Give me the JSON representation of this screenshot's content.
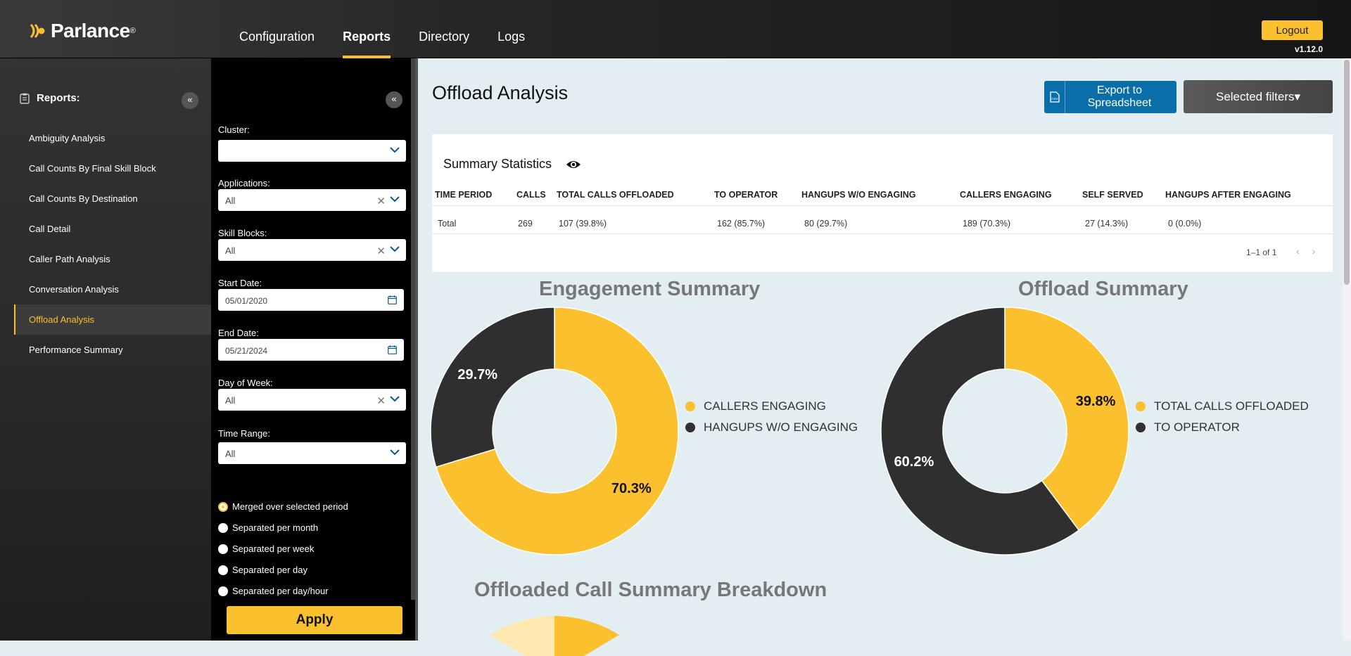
{
  "app": {
    "logo_text": "Parlance",
    "version": "v1.12.0",
    "logout": "Logout"
  },
  "nav": [
    "Configuration",
    "Reports",
    "Directory",
    "Logs"
  ],
  "sidebar": {
    "heading": "Reports:",
    "collapse_icon": "chevrons-left-icon",
    "items": [
      "Ambiguity Analysis",
      "Call Counts By Final Skill Block",
      "Call Counts By Destination",
      "Call Detail",
      "Caller Path Analysis",
      "Conversation Analysis",
      "Offload Analysis",
      "Performance Summary"
    ],
    "active": "Offload Analysis"
  },
  "filters": {
    "cluster_label": "Cluster:",
    "cluster_value": "",
    "applications_label": "Applications:",
    "applications_value": "All",
    "skill_blocks_label": "Skill Blocks:",
    "skill_blocks_value": "All",
    "start_date_label": "Start Date:",
    "start_date_value": "05/01/2020",
    "end_date_label": "End Date:",
    "end_date_value": "05/21/2024",
    "day_of_week_label": "Day of Week:",
    "day_of_week_value": "All",
    "time_range_label": "Time Range:",
    "time_range_value": "All",
    "grouping_options": [
      "Merged over selected period",
      "Separated per month",
      "Separated per week",
      "Separated per day",
      "Separated per day/hour"
    ],
    "grouping_selected": "Merged over selected period",
    "apply": "Apply"
  },
  "main": {
    "title": "Offload Analysis",
    "export_button": "Export to Spreadsheet",
    "filters_button": "Selected filters▾",
    "summary": {
      "title": "Summary Statistics",
      "columns": [
        "TIME PERIOD",
        "CALLS",
        "TOTAL CALLS OFFLOADED",
        "TO OPERATOR",
        "HANGUPS W/O ENGAGING",
        "CALLERS ENGAGING",
        "SELF SERVED",
        "HANGUPS AFTER ENGAGING"
      ],
      "rows": [
        [
          "Total",
          "269",
          "107 (39.8%)",
          "162 (85.7%)",
          "80 (29.7%)",
          "189 (70.3%)",
          "27 (14.3%)",
          "0 (0.0%)"
        ]
      ],
      "pager": "1–1 of 1"
    },
    "breakdown_title": "Offloaded Call Summary Breakdown"
  },
  "colors": {
    "accent": "#fbc02d",
    "dark": "#2f2f2f",
    "export_blue": "#0a6fa8"
  },
  "chart_data": [
    {
      "type": "pie",
      "title": "Engagement Summary",
      "labels": [
        "CALLERS ENGAGING",
        "HANGUPS W/O ENGAGING"
      ],
      "values": [
        70.3,
        29.7
      ],
      "value_labels": [
        "70.3%",
        "29.7%"
      ],
      "colors": [
        "#fbc02d",
        "#2f2f2f"
      ],
      "legend": "right"
    },
    {
      "type": "pie",
      "title": "Offload Summary",
      "labels": [
        "TOTAL CALLS OFFLOADED",
        "TO OPERATOR"
      ],
      "values": [
        39.8,
        60.2
      ],
      "value_labels": [
        "39.8%",
        "60.2%"
      ],
      "colors": [
        "#fbc02d",
        "#2f2f2f"
      ],
      "legend": "right"
    }
  ]
}
